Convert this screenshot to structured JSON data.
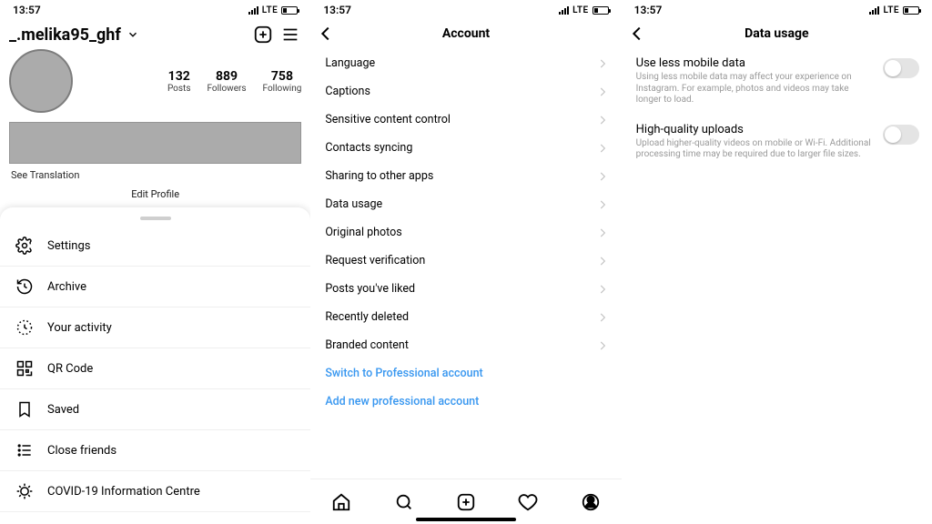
{
  "status": {
    "time": "13:57",
    "net": "LTE"
  },
  "profile": {
    "username": "_.melika95_ghf",
    "stats": [
      {
        "n": "132",
        "l": "Posts"
      },
      {
        "n": "889",
        "l": "Followers"
      },
      {
        "n": "758",
        "l": "Following"
      }
    ],
    "see_translation": "See Translation",
    "edit_profile": "Edit Profile"
  },
  "sheet": {
    "items": [
      {
        "label": "Settings",
        "icon": "gear"
      },
      {
        "label": "Archive",
        "icon": "archive"
      },
      {
        "label": "Your activity",
        "icon": "activity"
      },
      {
        "label": "QR Code",
        "icon": "qr"
      },
      {
        "label": "Saved",
        "icon": "bookmark"
      },
      {
        "label": "Close friends",
        "icon": "list"
      },
      {
        "label": "COVID-19 Information Centre",
        "icon": "covid"
      }
    ]
  },
  "account": {
    "title": "Account",
    "items": [
      "Language",
      "Captions",
      "Sensitive content control",
      "Contacts syncing",
      "Sharing to other apps",
      "Data usage",
      "Original photos",
      "Request verification",
      "Posts you've liked",
      "Recently deleted",
      "Branded content"
    ],
    "links": [
      "Switch to Professional account",
      "Add new professional account"
    ]
  },
  "data_usage": {
    "title": "Data usage",
    "rows": [
      {
        "title": "Use less mobile data",
        "sub": "Using less mobile data may affect your experience on Instagram. For example, photos and videos may take longer to load."
      },
      {
        "title": "High-quality uploads",
        "sub": "Upload higher-quality videos on mobile or Wi-Fi. Additional processing time may be required due to larger file sizes."
      }
    ]
  }
}
